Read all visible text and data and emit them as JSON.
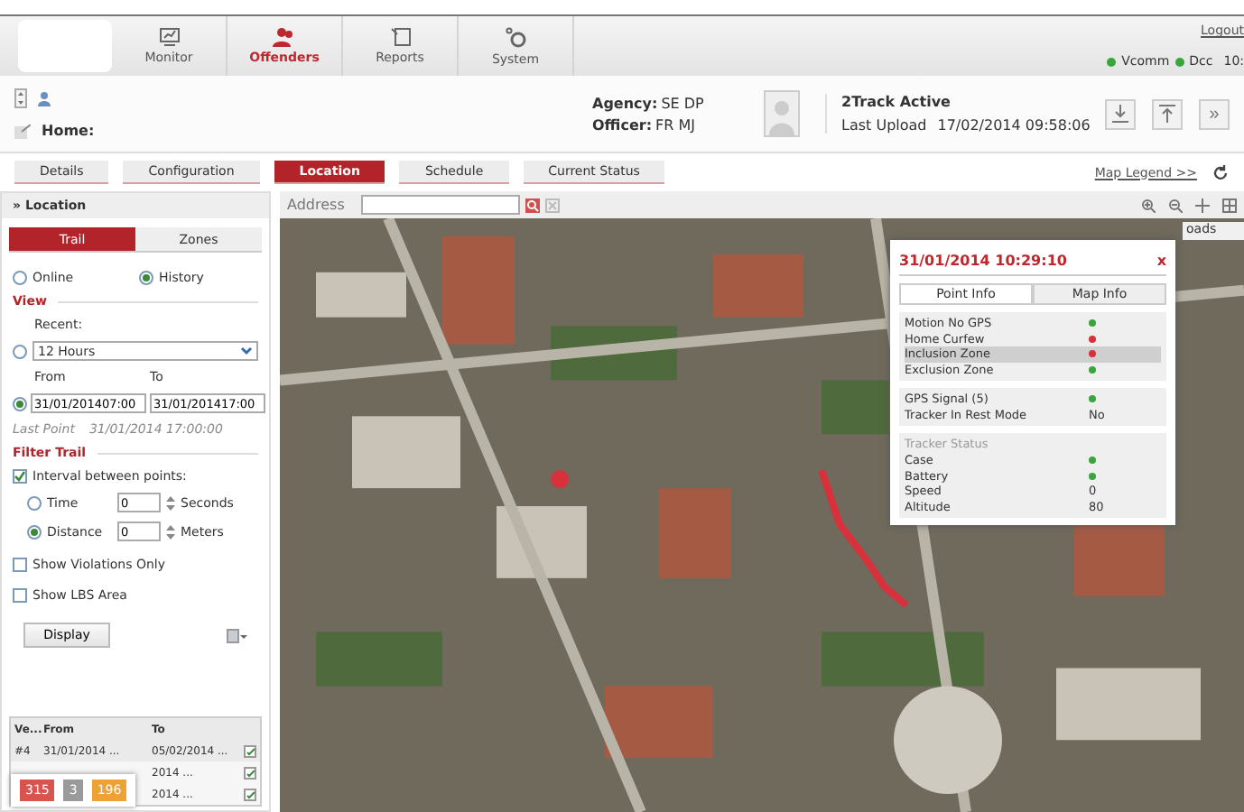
{
  "nav": {
    "items": [
      {
        "label": "Monitor",
        "selected": false,
        "kind": "monitor"
      },
      {
        "label": "Offenders",
        "selected": true,
        "kind": "offenders"
      },
      {
        "label": "Reports",
        "selected": false,
        "kind": "reports"
      },
      {
        "label": "System",
        "selected": false,
        "kind": "system"
      }
    ],
    "logout": "Logout",
    "servers": [
      {
        "label": "Vcomm",
        "color": "#3aa53a"
      },
      {
        "label": "Dcc",
        "color": "#3aa53a"
      }
    ],
    "clock": "10:"
  },
  "offender": {
    "home_label": "Home:",
    "agency_label": "Agency:",
    "agency": "SE DP",
    "officer_label": "Officer:",
    "officer": "FR MJ",
    "device": "2Track Active",
    "upload_label": "Last Upload",
    "upload": "17/02/2014 09:58:06",
    "more": "»"
  },
  "tabs": [
    {
      "label": "Details",
      "selected": false
    },
    {
      "label": "Configuration",
      "selected": false
    },
    {
      "label": "Location",
      "selected": true
    },
    {
      "label": "Schedule",
      "selected": false
    },
    {
      "label": "Current Status",
      "selected": false
    }
  ],
  "map_legend": "Map Legend >>",
  "panel": {
    "title": "» Location",
    "tabs": [
      {
        "label": "Trail",
        "selected": true
      },
      {
        "label": "Zones",
        "selected": false
      }
    ],
    "modes": [
      {
        "label": "Online",
        "selected": false
      },
      {
        "label": "History",
        "selected": true
      }
    ],
    "view_heading": "View",
    "recent_label": "Recent:",
    "recent_selected": false,
    "recent_value": "12 Hours",
    "from_label": "From",
    "to_label": "To",
    "range_selected": true,
    "from": "31/01/201407:00",
    "to": "31/01/201417:00",
    "last_point_label": "Last Point",
    "last_point": "31/01/2014 17:00:00",
    "filter_heading": "Filter Trail",
    "interval_label": "Interval between points:",
    "interval_checked": true,
    "intervals": [
      {
        "label": "Time",
        "value": "0",
        "unit": "Seconds",
        "selected": false
      },
      {
        "label": "Distance",
        "value": "0",
        "unit": "Meters",
        "selected": true
      }
    ],
    "options": [
      {
        "label": "Show Violations Only",
        "checked": false
      },
      {
        "label": "Show LBS Area",
        "checked": false
      }
    ],
    "display": "Display"
  },
  "table": {
    "columns": [
      "Ve...",
      "From",
      "To"
    ],
    "rows": [
      {
        "cells": [
          "#4",
          "31/01/2014 ...",
          "05/02/2014 ..."
        ]
      },
      {
        "cells": [
          "",
          "",
          "2014 ..."
        ]
      },
      {
        "cells": [
          "",
          "",
          "2014 ..."
        ]
      }
    ]
  },
  "counters": [
    {
      "value": "315",
      "color": "#d9534f"
    },
    {
      "value": "3",
      "color": "#9a9a9a"
    },
    {
      "value": "196",
      "color": "#eea236"
    }
  ],
  "map": {
    "address_label": "Address",
    "map_tab": "oads",
    "popup": {
      "title": "31/01/2014 10:29:10",
      "close": "x",
      "tabs": [
        {
          "label": "Point Info",
          "selected": true
        },
        {
          "label": "Map Info",
          "selected": false
        }
      ],
      "groups": [
        {
          "rows": [
            {
              "label": "Motion No GPS",
              "kind": "dot",
              "color": "#3aa53a",
              "selected": false
            },
            {
              "label": "Home Curfew",
              "kind": "dot",
              "color": "#d8313c",
              "selected": false
            },
            {
              "label": "Inclusion Zone",
              "kind": "dot",
              "color": "#d8313c",
              "selected": true
            },
            {
              "label": "Exclusion Zone",
              "kind": "dot",
              "color": "#3aa53a",
              "selected": false
            }
          ]
        },
        {
          "rows": [
            {
              "label": "GPS Signal  (5)",
              "kind": "dot",
              "color": "#3aa53a",
              "selected": false
            },
            {
              "label": "Tracker In Rest Mode",
              "kind": "text",
              "value": "No",
              "selected": false
            }
          ]
        },
        {
          "heading": "Tracker Status",
          "rows": [
            {
              "label": "Case",
              "kind": "dot",
              "color": "#3aa53a",
              "selected": false
            },
            {
              "label": "Battery",
              "kind": "dot",
              "color": "#3aa53a",
              "selected": false
            },
            {
              "label": "Speed",
              "kind": "text",
              "value": "0",
              "selected": false
            },
            {
              "label": "Altitude",
              "kind": "text",
              "value": "80",
              "selected": false
            }
          ]
        }
      ]
    }
  }
}
